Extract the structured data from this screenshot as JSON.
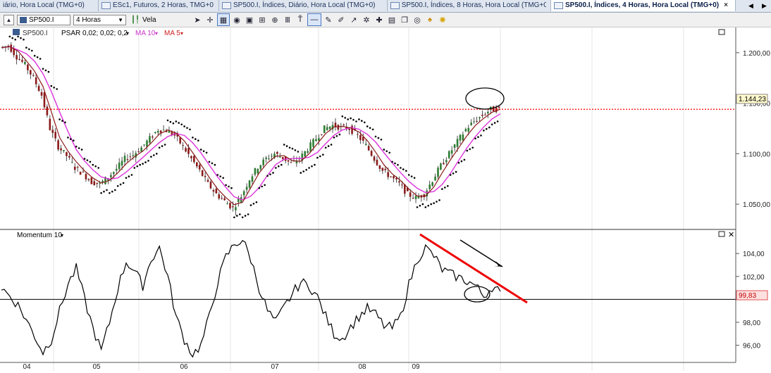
{
  "tabs": [
    {
      "label": "iário, Hora Local (TMG+0)",
      "active": false
    },
    {
      "label": "ESc1, Futuros, 2 Horas, TMG+0",
      "active": false
    },
    {
      "label": "SP500.I, Índices, Diário, Hora Local (TMG+0)",
      "active": false
    },
    {
      "label": "SP500.I, Índices, 8 Horas, Hora Local (TMG+0)",
      "active": false
    },
    {
      "label": "SP500.I, Índices, 4 Horas, Hora Local (TMG+0)",
      "active": true
    }
  ],
  "toolbar": {
    "symbol": "SP500.I",
    "interval": "4 Horas",
    "chart_type": "Vela",
    "icons": [
      "scroll-up-icon",
      "cursor-icon",
      "crosshair-icon",
      "grid-icon",
      "zoom-icon",
      "draw-icon",
      "zoom-in-icon",
      "zoom-out-icon",
      "line-icon",
      "pencil-icon",
      "brush-icon",
      "arrow-icon",
      "settings-icon",
      "calendar-icon",
      "copy-icon",
      "alert-icon",
      "bell-icon",
      "star-icon"
    ]
  },
  "price_panel": {
    "symbol_label": "SP500.I",
    "indicators": [
      {
        "label": "PSAR 0,02; 0,02; 0,2",
        "color": "#000000"
      },
      {
        "label": "MA 10",
        "color": "#cc33cc"
      },
      {
        "label": "MA 5",
        "color": "#8b1a1a"
      }
    ],
    "y_ticks": [
      "1.200,00",
      "1.150,00",
      "1.100,00",
      "1.050,00"
    ],
    "current_price": "1.144,23",
    "colors": {
      "up": "#2e7d32",
      "down": "#8b1a1a",
      "ma10": "#dd33dd",
      "ma5": "#8b1a1a",
      "psar": "#000000",
      "price_line": "#ff0000"
    }
  },
  "momentum_panel": {
    "label": "Momentum 10",
    "y_ticks": [
      "104,00",
      "102,00",
      "100",
      "98,00",
      "96,00"
    ],
    "current_value": "99,83",
    "colors": {
      "line": "#000000",
      "trendline": "#ee0000",
      "reference": "#000000"
    }
  },
  "x_axis": {
    "labels": [
      "04",
      "05",
      "06",
      "07",
      "08",
      "09"
    ]
  },
  "chart_data": [
    {
      "type": "line",
      "title": "SP500.I, Índices, 4 Horas",
      "x": [
        "04",
        "05",
        "06",
        "07",
        "08",
        "09"
      ],
      "series": [
        {
          "name": "SP500.I",
          "values": [
            1205,
            1207,
            1196,
            1188,
            1175,
            1158,
            1125,
            1107,
            1098,
            1086,
            1080,
            1072,
            1070,
            1077,
            1085,
            1095,
            1099,
            1106,
            1115,
            1124,
            1123,
            1118,
            1107,
            1095,
            1083,
            1070,
            1060,
            1053,
            1046,
            1058,
            1075,
            1087,
            1095,
            1100,
            1096,
            1090,
            1095,
            1105,
            1115,
            1125,
            1128,
            1126,
            1125,
            1118,
            1108,
            1095,
            1083,
            1077,
            1070,
            1060,
            1056,
            1060,
            1074,
            1088,
            1100,
            1112,
            1124,
            1132,
            1138,
            1144,
            1144
          ]
        }
      ],
      "ylim": [
        1025,
        1225
      ]
    },
    {
      "type": "line",
      "title": "Momentum 10",
      "series": [
        {
          "name": "Momentum 10",
          "values": [
            101,
            100.3,
            99.5,
            98.2,
            96.8,
            95.4,
            96.5,
            99,
            101.3,
            102.7,
            100,
            97.5,
            95.5,
            98,
            101,
            103.3,
            102.5,
            101.2,
            103.5,
            104.5,
            102,
            98.5,
            96.5,
            95.2,
            96,
            98.5,
            101.5,
            103.7,
            104.8,
            105.2,
            103.5,
            101,
            99,
            98,
            99.3,
            100.5,
            101.5,
            101.2,
            100.2,
            98.5,
            97,
            96.6,
            97.6,
            98.5,
            99.2,
            98.7,
            97.7,
            97.5,
            98.5,
            101.3,
            103.5,
            104.5,
            103.8,
            102.6,
            102.2,
            101.9,
            101.6,
            101.2,
            100.3,
            101.1,
            100.7
          ]
        }
      ],
      "ylim": [
        94.5,
        106.1
      ],
      "reference_line": 100
    }
  ]
}
